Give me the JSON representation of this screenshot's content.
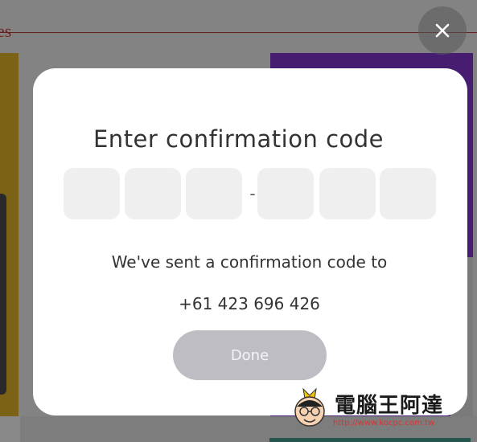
{
  "background": {
    "partial_text": "es"
  },
  "modal": {
    "title": "Enter confirmation code",
    "separator": "-",
    "info_text": "We've sent a confirmation code to",
    "phone_number": "+61 423 696 426",
    "done_label": "Done",
    "code_slots": [
      "",
      "",
      "",
      "",
      "",
      ""
    ]
  },
  "close": {
    "icon": "close-icon"
  },
  "watermark": {
    "title": "電腦王阿達",
    "url": "http://www.kocpc.com.tw"
  },
  "colors": {
    "done_button": "#bdbdc3",
    "code_box": "#efefef",
    "bg_purple": "#6a10c8",
    "bg_yellow": "#e0a800"
  }
}
